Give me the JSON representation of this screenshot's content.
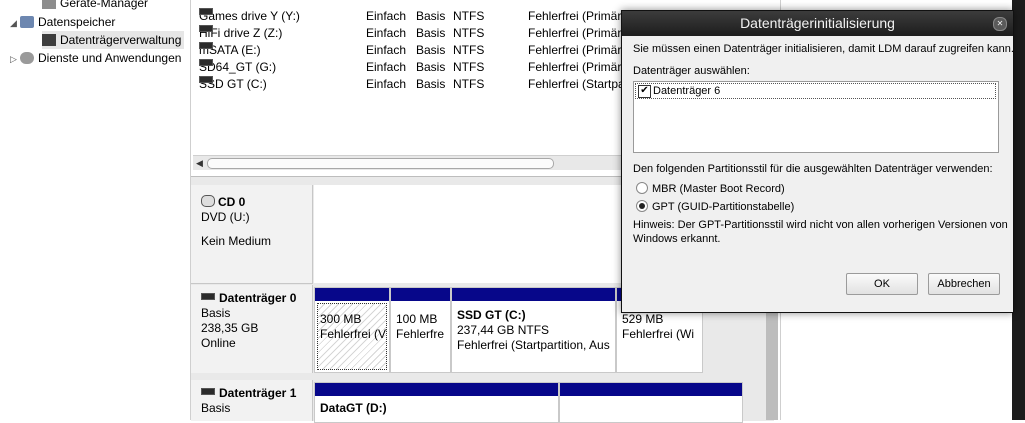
{
  "tree": {
    "items": [
      {
        "label": "Geräte-Manager",
        "expander": ""
      },
      {
        "label": "Datenspeicher",
        "expander": "◢"
      },
      {
        "label": "Datenträgerverwaltung",
        "expander": ""
      },
      {
        "label": "Dienste und Anwendungen",
        "expander": "▷"
      }
    ]
  },
  "volumes": {
    "rows": [
      {
        "name": "Games drive Y (Y:)",
        "layout": "Einfach",
        "type": "Basis",
        "fs": "NTFS",
        "status": "Fehlerfrei (Primäre"
      },
      {
        "name": "HiFi drive Z (Z:)",
        "layout": "Einfach",
        "type": "Basis",
        "fs": "NTFS",
        "status": "Fehlerfrei (Primäre"
      },
      {
        "name": "mSATA (E:)",
        "layout": "Einfach",
        "type": "Basis",
        "fs": "NTFS",
        "status": "Fehlerfrei (Primäre"
      },
      {
        "name": "SD64_GT (G:)",
        "layout": "Einfach",
        "type": "Basis",
        "fs": "NTFS",
        "status": "Fehlerfrei (Primäre"
      },
      {
        "name": "SSD GT (C:)",
        "layout": "Einfach",
        "type": "Basis",
        "fs": "NTFS",
        "status": "Fehlerfrei (Startpar"
      }
    ]
  },
  "disks": {
    "cd0": {
      "name": "CD 0",
      "line1": "DVD (U:)",
      "line2": "Kein Medium"
    },
    "disk0": {
      "name": "Datenträger 0",
      "type": "Basis",
      "size": "238,35 GB",
      "state": "Online",
      "partitions": [
        {
          "line1": "300 MB",
          "line2": "Fehlerfrei (V"
        },
        {
          "line1": "100 MB",
          "line2": "Fehlerfre"
        },
        {
          "title": "SSD GT  (C:)",
          "line1": "237,44 GB NTFS",
          "line2": "Fehlerfrei (Startpartition, Aus"
        },
        {
          "line1": "529 MB",
          "line2": "Fehlerfrei (Wi"
        }
      ]
    },
    "disk1": {
      "name": "Datenträger 1",
      "type": "Basis",
      "partitions": [
        {
          "title": "DataGT  (D:)"
        }
      ]
    }
  },
  "dialog": {
    "title": "Datenträgerinitialisierung",
    "intro": "Sie müssen einen Datenträger initialisieren, damit LDM darauf zugreifen kann.",
    "select_label": "Datenträger auswählen:",
    "disk_item": "Datenträger 6",
    "disk_checked": true,
    "style_label": "Den folgenden Partitionsstil für die ausgewählten Datenträger verwenden:",
    "options": [
      {
        "label": "MBR (Master Boot Record)",
        "selected": false
      },
      {
        "label": "GPT (GUID-Partitionstabelle)",
        "selected": true
      }
    ],
    "hint_line1": "Hinweis: Der GPT-Partitionsstil wird nicht von allen vorherigen Versionen von",
    "hint_line2": "Windows erkannt.",
    "ok_label": "OK",
    "cancel_label": "Abbrechen"
  },
  "colors": {
    "partition_bar": "#07078a",
    "dialog_title_bg": "#1d1d1d"
  }
}
